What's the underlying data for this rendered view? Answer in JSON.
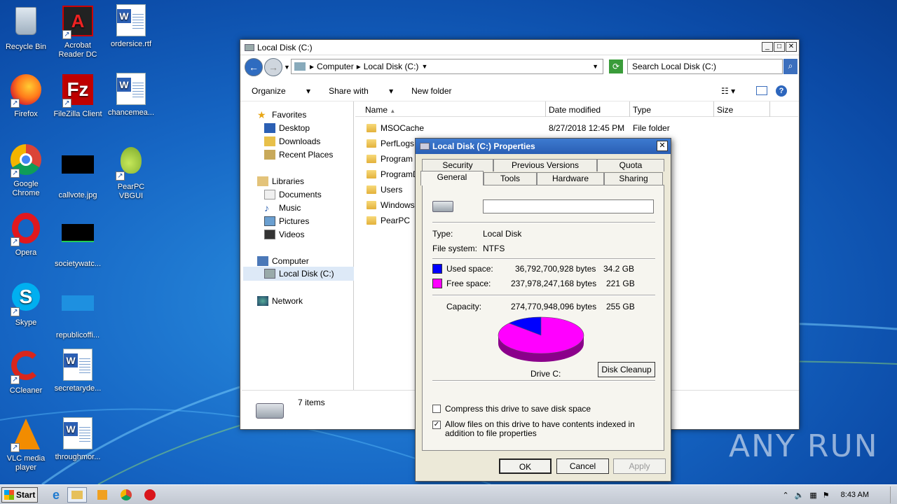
{
  "desktop": {
    "icons": [
      {
        "label": "Recycle Bin"
      },
      {
        "label": "Acrobat Reader DC"
      },
      {
        "label": "ordersice.rtf"
      },
      {
        "label": "Firefox"
      },
      {
        "label": "FileZilla Client"
      },
      {
        "label": "chancemea..."
      },
      {
        "label": "Google Chrome"
      },
      {
        "label": "callvote.jpg"
      },
      {
        "label": "PearPC VBGUI"
      },
      {
        "label": "Opera"
      },
      {
        "label": "societywatc..."
      },
      {
        "label": "Skype"
      },
      {
        "label": "republicoffi..."
      },
      {
        "label": "CCleaner"
      },
      {
        "label": "secretaryde..."
      },
      {
        "label": "VLC media player"
      },
      {
        "label": "throughmor..."
      }
    ]
  },
  "explorer": {
    "title": "Local Disk (C:)",
    "breadcrumb": [
      "Computer",
      "Local Disk (C:)"
    ],
    "search_placeholder": "Search Local Disk (C:)",
    "toolbar": {
      "organize": "Organize",
      "share_with": "Share with",
      "new_folder": "New folder"
    },
    "nav": {
      "favorites": "Favorites",
      "desktop": "Desktop",
      "downloads": "Downloads",
      "recent": "Recent Places",
      "libraries": "Libraries",
      "documents": "Documents",
      "music": "Music",
      "pictures": "Pictures",
      "videos": "Videos",
      "computer": "Computer",
      "local_disk": "Local Disk (C:)",
      "network": "Network"
    },
    "columns": {
      "name": "Name",
      "date": "Date modified",
      "type": "Type",
      "size": "Size"
    },
    "files": [
      {
        "name": "MSOCache",
        "date": "8/27/2018 12:45 PM",
        "type": "File folder"
      },
      {
        "name": "PerfLogs"
      },
      {
        "name": "Program F"
      },
      {
        "name": "ProgramD"
      },
      {
        "name": "Users"
      },
      {
        "name": "Windows"
      },
      {
        "name": "PearPC"
      }
    ],
    "status": "7 items"
  },
  "properties": {
    "title": "Local Disk (C:) Properties",
    "tabs_top": [
      "Security",
      "Previous Versions",
      "Quota"
    ],
    "tabs_bottom": [
      "General",
      "Tools",
      "Hardware",
      "Sharing"
    ],
    "name_value": "",
    "type_label": "Type:",
    "type_value": "Local Disk",
    "fs_label": "File system:",
    "fs_value": "NTFS",
    "used_label": "Used space:",
    "used_bytes": "36,792,700,928 bytes",
    "used_gb": "34.2 GB",
    "free_label": "Free space:",
    "free_bytes": "237,978,247,168 bytes",
    "free_gb": "221 GB",
    "cap_label": "Capacity:",
    "cap_bytes": "274,770,948,096 bytes",
    "cap_gb": "255 GB",
    "used_fraction": 0.134,
    "used_color": "#0000ff",
    "free_color": "#ff00ff",
    "drive_label": "Drive C:",
    "disk_cleanup": "Disk Cleanup",
    "compress_label": "Compress this drive to save disk space",
    "compress_checked": false,
    "index_label": "Allow files on this drive to have contents indexed in addition to file properties",
    "index_checked": true,
    "ok": "OK",
    "cancel": "Cancel",
    "apply": "Apply"
  },
  "taskbar": {
    "start": "Start",
    "time": "8:43 AM"
  },
  "watermark": "ANY RUN"
}
